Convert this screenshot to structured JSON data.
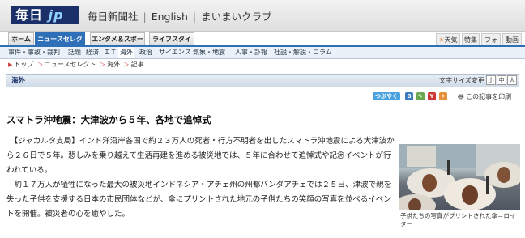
{
  "header": {
    "logo_main": "毎日",
    "logo_jp": "jp",
    "links": [
      "毎日新聞社",
      "English",
      "まいまいクラブ"
    ]
  },
  "nav_tabs": [
    {
      "label": "ホーム",
      "active": false
    },
    {
      "label": "ニュースセレクト",
      "active": true
    },
    {
      "label": "エンタメ＆スポーツ",
      "active": false
    },
    {
      "label": "ライフスタイル",
      "active": false
    }
  ],
  "util_tabs": [
    "天気",
    "特集",
    "フォト",
    "動画"
  ],
  "subnav": [
    "事件・事故・裁判",
    "話題",
    "経済",
    "ＩＴ",
    "海外",
    "政治",
    "サイエンス",
    "気象・地震",
    "人事・訃報",
    "社説・解説・コラム"
  ],
  "breadcrumb": [
    "トップ",
    "ニュースセレクト",
    "海外",
    "記事"
  ],
  "section_title": "海外",
  "font_size": {
    "label": "文字サイズ変更",
    "options": [
      "小",
      "中",
      "大"
    ]
  },
  "share": {
    "tweet": "つぶやく",
    "print": "この記事を印刷"
  },
  "article": {
    "headline": "スマトラ沖地震：大津波から５年、各地で追悼式",
    "paragraph1": "　【ジャカルタ支局】インド洋沿岸各国で約２３万人の死者・行方不明者を出したスマトラ沖地震による大津波から２６日で５年。悲しみを乗り越えて生活再建を進める被災地では、５年に合わせて追悼式や記念イベントが行われている。",
    "paragraph2": "　約１７万人が犠牲になった最大の被災地インドネシア・アチェ州の州都バンダアチェでは２５日、津波で親を失った子供を支援する日本の市民団体などが、傘にプリントされた地元の子供たちの笑顔の写真を並べるイベントを開催。被災者の心を癒やした。",
    "photo_caption": "子供たちの写真がプリントされた傘＝ロイター"
  }
}
